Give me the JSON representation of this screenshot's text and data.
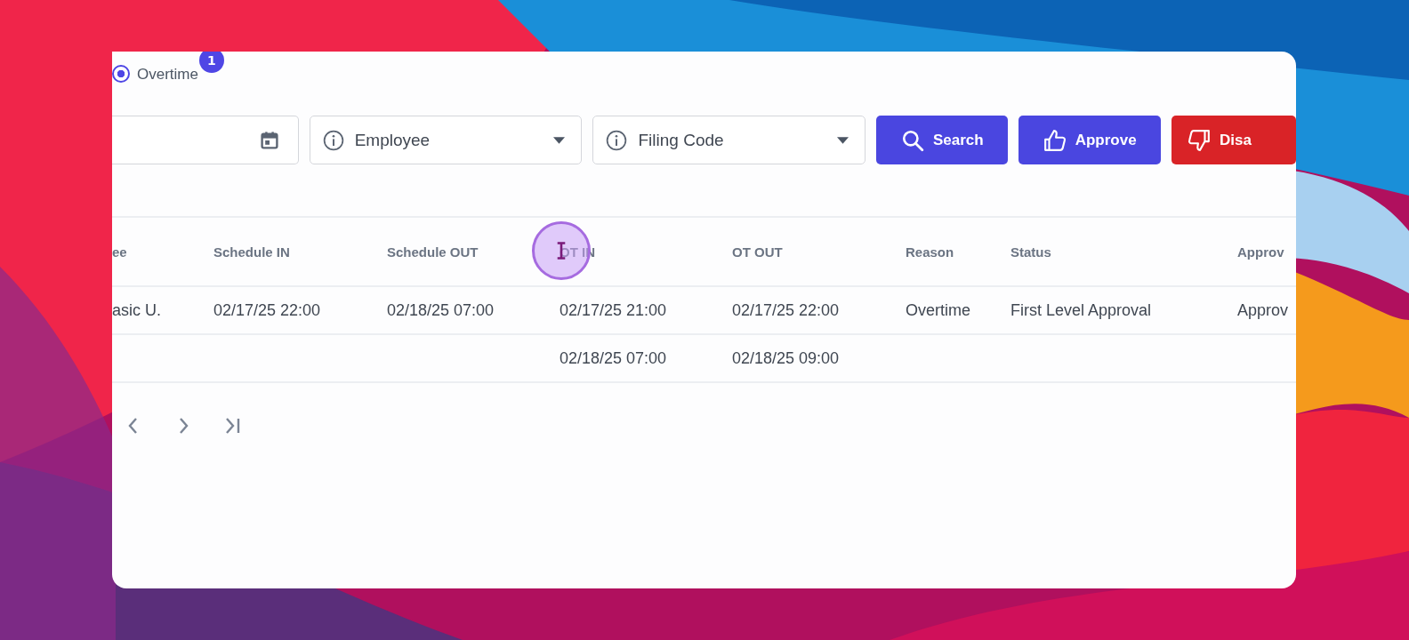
{
  "filter_type": {
    "label": "Overtime",
    "selected": true,
    "badge": "1"
  },
  "filters": [
    {
      "kind": "date"
    },
    {
      "kind": "select",
      "placeholder": "Employee"
    },
    {
      "kind": "select",
      "placeholder": "Filing Code"
    }
  ],
  "buttons": [
    {
      "kind": "search",
      "label": "Search"
    },
    {
      "kind": "approve",
      "label": "Approve"
    },
    {
      "kind": "disapprove",
      "label": "Disa"
    }
  ],
  "table": {
    "columns": [
      "ee",
      "Schedule IN",
      "Schedule OUT",
      "OT IN",
      "OT OUT",
      "Reason",
      "Status",
      "Approv"
    ],
    "rows": [
      [
        "asic U.",
        "02/17/25 22:00",
        "02/18/25 07:00",
        "02/17/25 21:00",
        "02/17/25 22:00",
        "Overtime",
        "First Level Approval",
        "Approv"
      ],
      [
        "",
        "",
        "",
        "02/18/25 07:00",
        "02/18/25 09:00",
        "",
        "",
        ""
      ]
    ]
  },
  "pagination": [
    {
      "kind": "prev"
    },
    {
      "kind": "next"
    },
    {
      "kind": "last"
    }
  ]
}
